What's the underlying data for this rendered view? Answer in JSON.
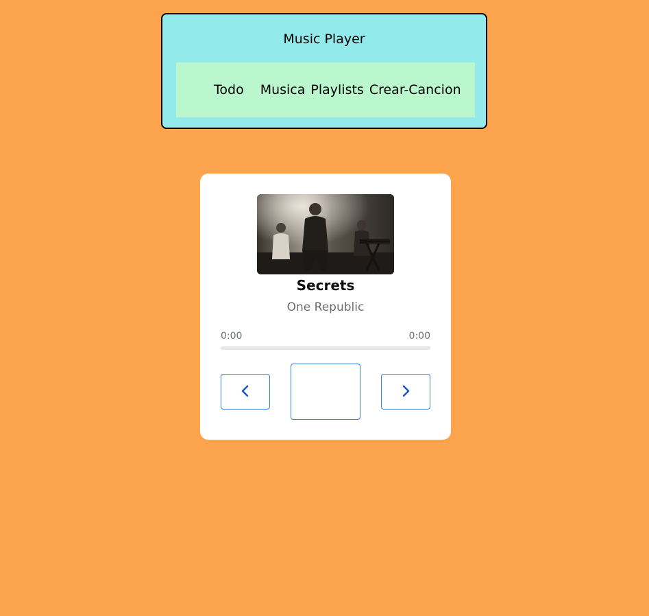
{
  "header": {
    "title": "Music Player",
    "nav": [
      {
        "label": "Todo"
      },
      {
        "label": "Musica"
      },
      {
        "label": "Playlists"
      },
      {
        "label": "Crear-Cancion"
      }
    ]
  },
  "player": {
    "song_title": "Secrets",
    "artist": "One Republic",
    "time_current": "0:00",
    "time_total": "0:00",
    "progress": 0,
    "controls": {
      "prev_icon": "chevron-left-icon",
      "next_icon": "chevron-right-icon"
    }
  },
  "colors": {
    "background": "#fca34d",
    "header_bg": "#92eaea",
    "nav_bg": "#baf7cd",
    "accent": "#2f6fd6"
  }
}
